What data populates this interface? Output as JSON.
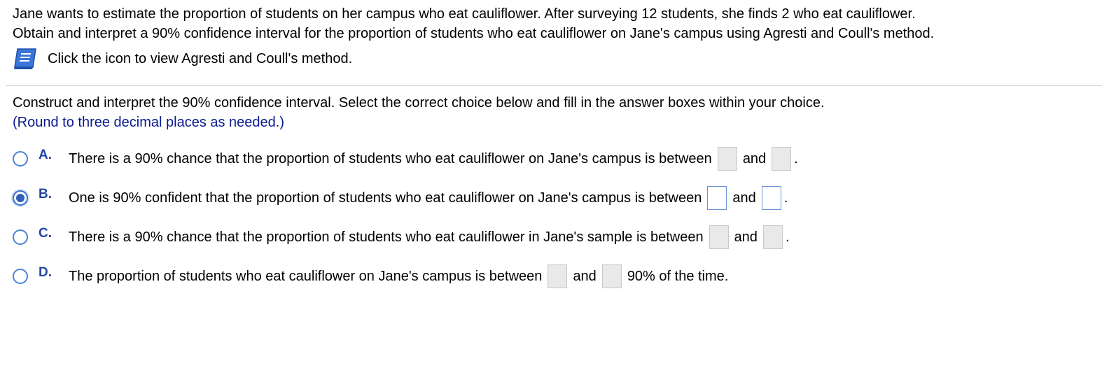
{
  "problem": {
    "line1": "Jane wants to estimate the proportion of students on her campus who eat cauliflower. After surveying 12 students, she finds 2 who eat cauliflower.",
    "line2": "Obtain and interpret a 90% confidence interval for the proportion of students who eat cauliflower on Jane's campus using Agresti and Coull's method."
  },
  "hint": {
    "icon": "book-icon",
    "text": "Click the icon to view Agresti and Coull's method."
  },
  "instructions": {
    "line1": "Construct and interpret the 90% confidence interval. Select the correct choice below and fill in the answer boxes within your choice.",
    "round_note": "(Round to three decimal places as needed.)"
  },
  "choices": [
    {
      "letter": "A.",
      "text": "There is a 90% chance that the proportion of students who eat cauliflower on Jane's campus is between",
      "and": "and",
      "end": ".",
      "selected": false
    },
    {
      "letter": "B.",
      "text": "One is 90% confident that the proportion of students who eat cauliflower on Jane's campus is between",
      "and": "and",
      "end": ".",
      "selected": true
    },
    {
      "letter": "C.",
      "text": "There is a 90% chance that the proportion of students who eat cauliflower in Jane's sample is between",
      "and": "and",
      "end": ".",
      "selected": false
    },
    {
      "letter": "D.",
      "text": "The proportion of students who eat cauliflower on Jane's campus is between",
      "and": "and",
      "end": "90% of the time.",
      "selected": false
    }
  ],
  "colors": {
    "accent": "#2147a6",
    "round_note": "#0b1b8f",
    "radio_border": "#4a84d4",
    "inactive_box": "#e9e9e9"
  }
}
